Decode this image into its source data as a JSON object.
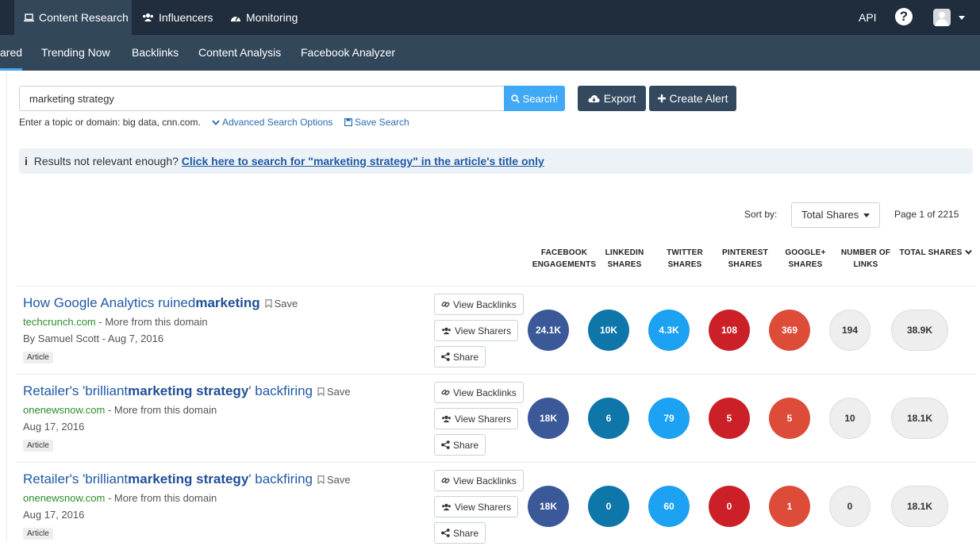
{
  "topnav": {
    "items": [
      {
        "label": "Content Research",
        "icon": "laptop-icon"
      },
      {
        "label": "Influencers",
        "icon": "users-icon"
      },
      {
        "label": "Monitoring",
        "icon": "dashboard-icon"
      }
    ],
    "api_label": "API",
    "help_label": "?"
  },
  "subnav": {
    "items": [
      "ared",
      "Trending Now",
      "Backlinks",
      "Content Analysis",
      "Facebook Analyzer"
    ]
  },
  "search": {
    "value": "marketing strategy",
    "button_label": "Search!",
    "export_label": "Export",
    "alert_label": "Create Alert",
    "hint": "Enter a topic or domain: big data, cnn.com.",
    "advanced_label": "Advanced Search Options",
    "save_search_label": "Save Search"
  },
  "notice": {
    "prefix": "Results not relevant enough?",
    "link": "Click here to search for \"marketing strategy\" in the article's title only"
  },
  "sort": {
    "label": "Sort by:",
    "selected": "Total Shares",
    "page_info": "Page 1 of 2215"
  },
  "columns": [
    [
      "FACEBOOK",
      "ENGAGEMENTS"
    ],
    [
      "LINKEDIN",
      "SHARES"
    ],
    [
      "TWITTER",
      "SHARES"
    ],
    [
      "PINTEREST",
      "SHARES"
    ],
    [
      "GOOGLE+",
      "SHARES"
    ],
    [
      "NUMBER OF",
      "LINKS"
    ],
    [
      "TOTAL SHARES",
      ""
    ]
  ],
  "colors": {
    "facebook": "#3b5998",
    "linkedin": "#0e76a8",
    "twitter": "#1da1f2",
    "pinterest": "#cb2027",
    "googleplus": "#dd4b39",
    "grey": "#eeeeee"
  },
  "action_labels": {
    "backlinks": "View Backlinks",
    "sharers": "View Sharers",
    "share": "Share",
    "save": "Save"
  },
  "results": [
    {
      "title_pre": "How Google Analytics ruined ",
      "title_bold": "marketing",
      "title_post": "",
      "domain": "techcrunch.com",
      "more": " - More from this domain",
      "meta": "By Samuel Scott - Aug 7, 2016",
      "tag": "Article",
      "stats": [
        "24.1K",
        "10K",
        "4.3K",
        "108",
        "369",
        "194",
        "38.9K"
      ]
    },
    {
      "title_pre": "Retailer's 'brilliant ",
      "title_bold": "marketing strategy",
      "title_post": "' backfiring",
      "domain": "onenewsnow.com",
      "more": " - More from this domain",
      "meta": "Aug 17, 2016",
      "tag": "Article",
      "stats": [
        "18K",
        "6",
        "79",
        "5",
        "5",
        "10",
        "18.1K"
      ]
    },
    {
      "title_pre": "Retailer's 'brilliant ",
      "title_bold": "marketing strategy",
      "title_post": "' backfiring",
      "domain": "onenewsnow.com",
      "more": " - More from this domain",
      "meta": "Aug 17, 2016",
      "tag": "Article",
      "stats": [
        "18K",
        "0",
        "60",
        "0",
        "1",
        "0",
        "18.1K"
      ]
    }
  ]
}
